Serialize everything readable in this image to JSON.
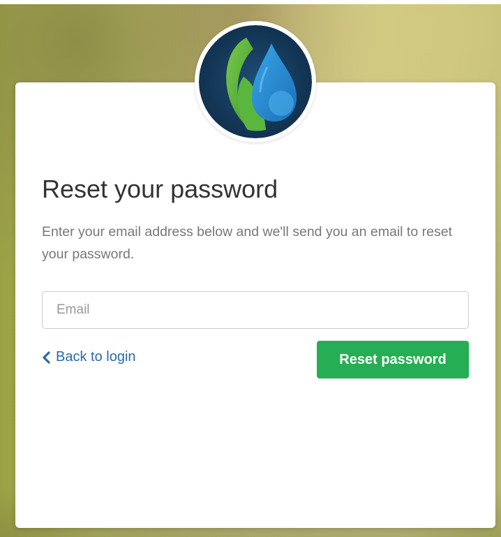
{
  "form": {
    "title": "Reset your password",
    "description": "Enter your email address below and we'll send you an email to reset your password.",
    "email_value": "",
    "email_placeholder": "Email",
    "back_label": "Back to login",
    "submit_label": "Reset password"
  },
  "icons": {
    "logo": "water-drop-leaf-logo",
    "back": "chevron-left-icon"
  },
  "colors": {
    "primary_button": "#26ae54",
    "link": "#2a6aa8",
    "logo_background": "#163a5c",
    "logo_drop": "#2a8fd6",
    "logo_leaf": "#5bb63d"
  }
}
